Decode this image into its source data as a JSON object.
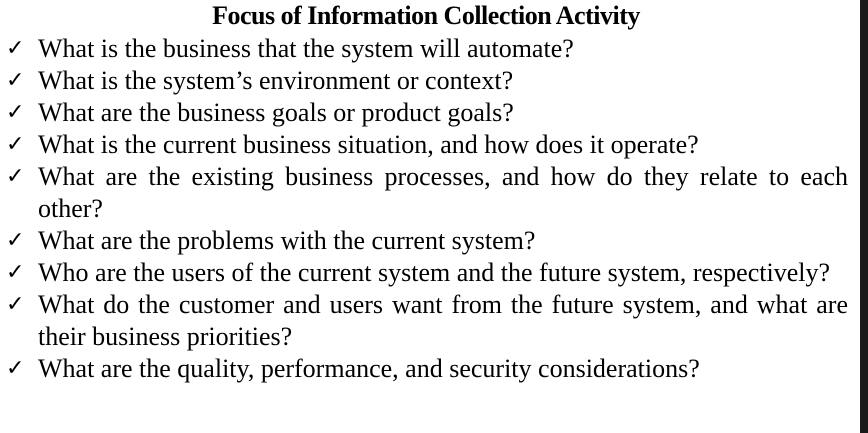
{
  "title": "Focus of Information Collection Activity",
  "check_glyph": "✓",
  "items": [
    "What is the business that the system will automate?",
    "What is the system’s environment or context?",
    "What are the business goals or product goals?",
    "What is the current business situation, and how does it operate?",
    "What are the existing business processes, and how do they relate to each other?",
    "What are the problems with the current system?",
    "Who are the users of the current system and the future system, respectively?",
    "What do the customer and users want from the future system, and what are their business priorities?",
    "What are the quality, performance, and security considerations?"
  ]
}
